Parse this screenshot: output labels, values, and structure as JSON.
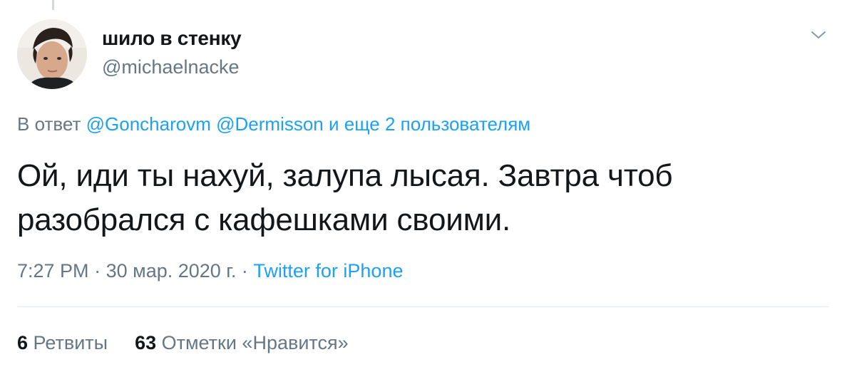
{
  "tweet": {
    "author": {
      "display_name": "шило в стенку",
      "handle": "@michaelnacke"
    },
    "menu_icon": "chevron-down-icon",
    "reply": {
      "prefix": "В ответ",
      "mention_1": "@Goncharovm",
      "mention_2": "@Dermisson",
      "suffix": "и еще 2 пользователям"
    },
    "text_lines": [
      "Ой, иди ты нахуй, залупа лысая. Завтра чтоб",
      "разобрался с кафешками своими."
    ],
    "meta": {
      "time": "7:27 PM",
      "separator": "·",
      "date": "30 мар. 2020 г.",
      "source": "Twitter for iPhone"
    },
    "stats": {
      "retweets_count": "6",
      "retweets_label": "Ретвиты",
      "likes_count": "63",
      "likes_label": "Отметки «Нравится»"
    },
    "colors": {
      "link": "#1da1f2",
      "secondary_text": "#657786",
      "primary_text": "#14171a",
      "divider": "#e1e8ed"
    }
  }
}
